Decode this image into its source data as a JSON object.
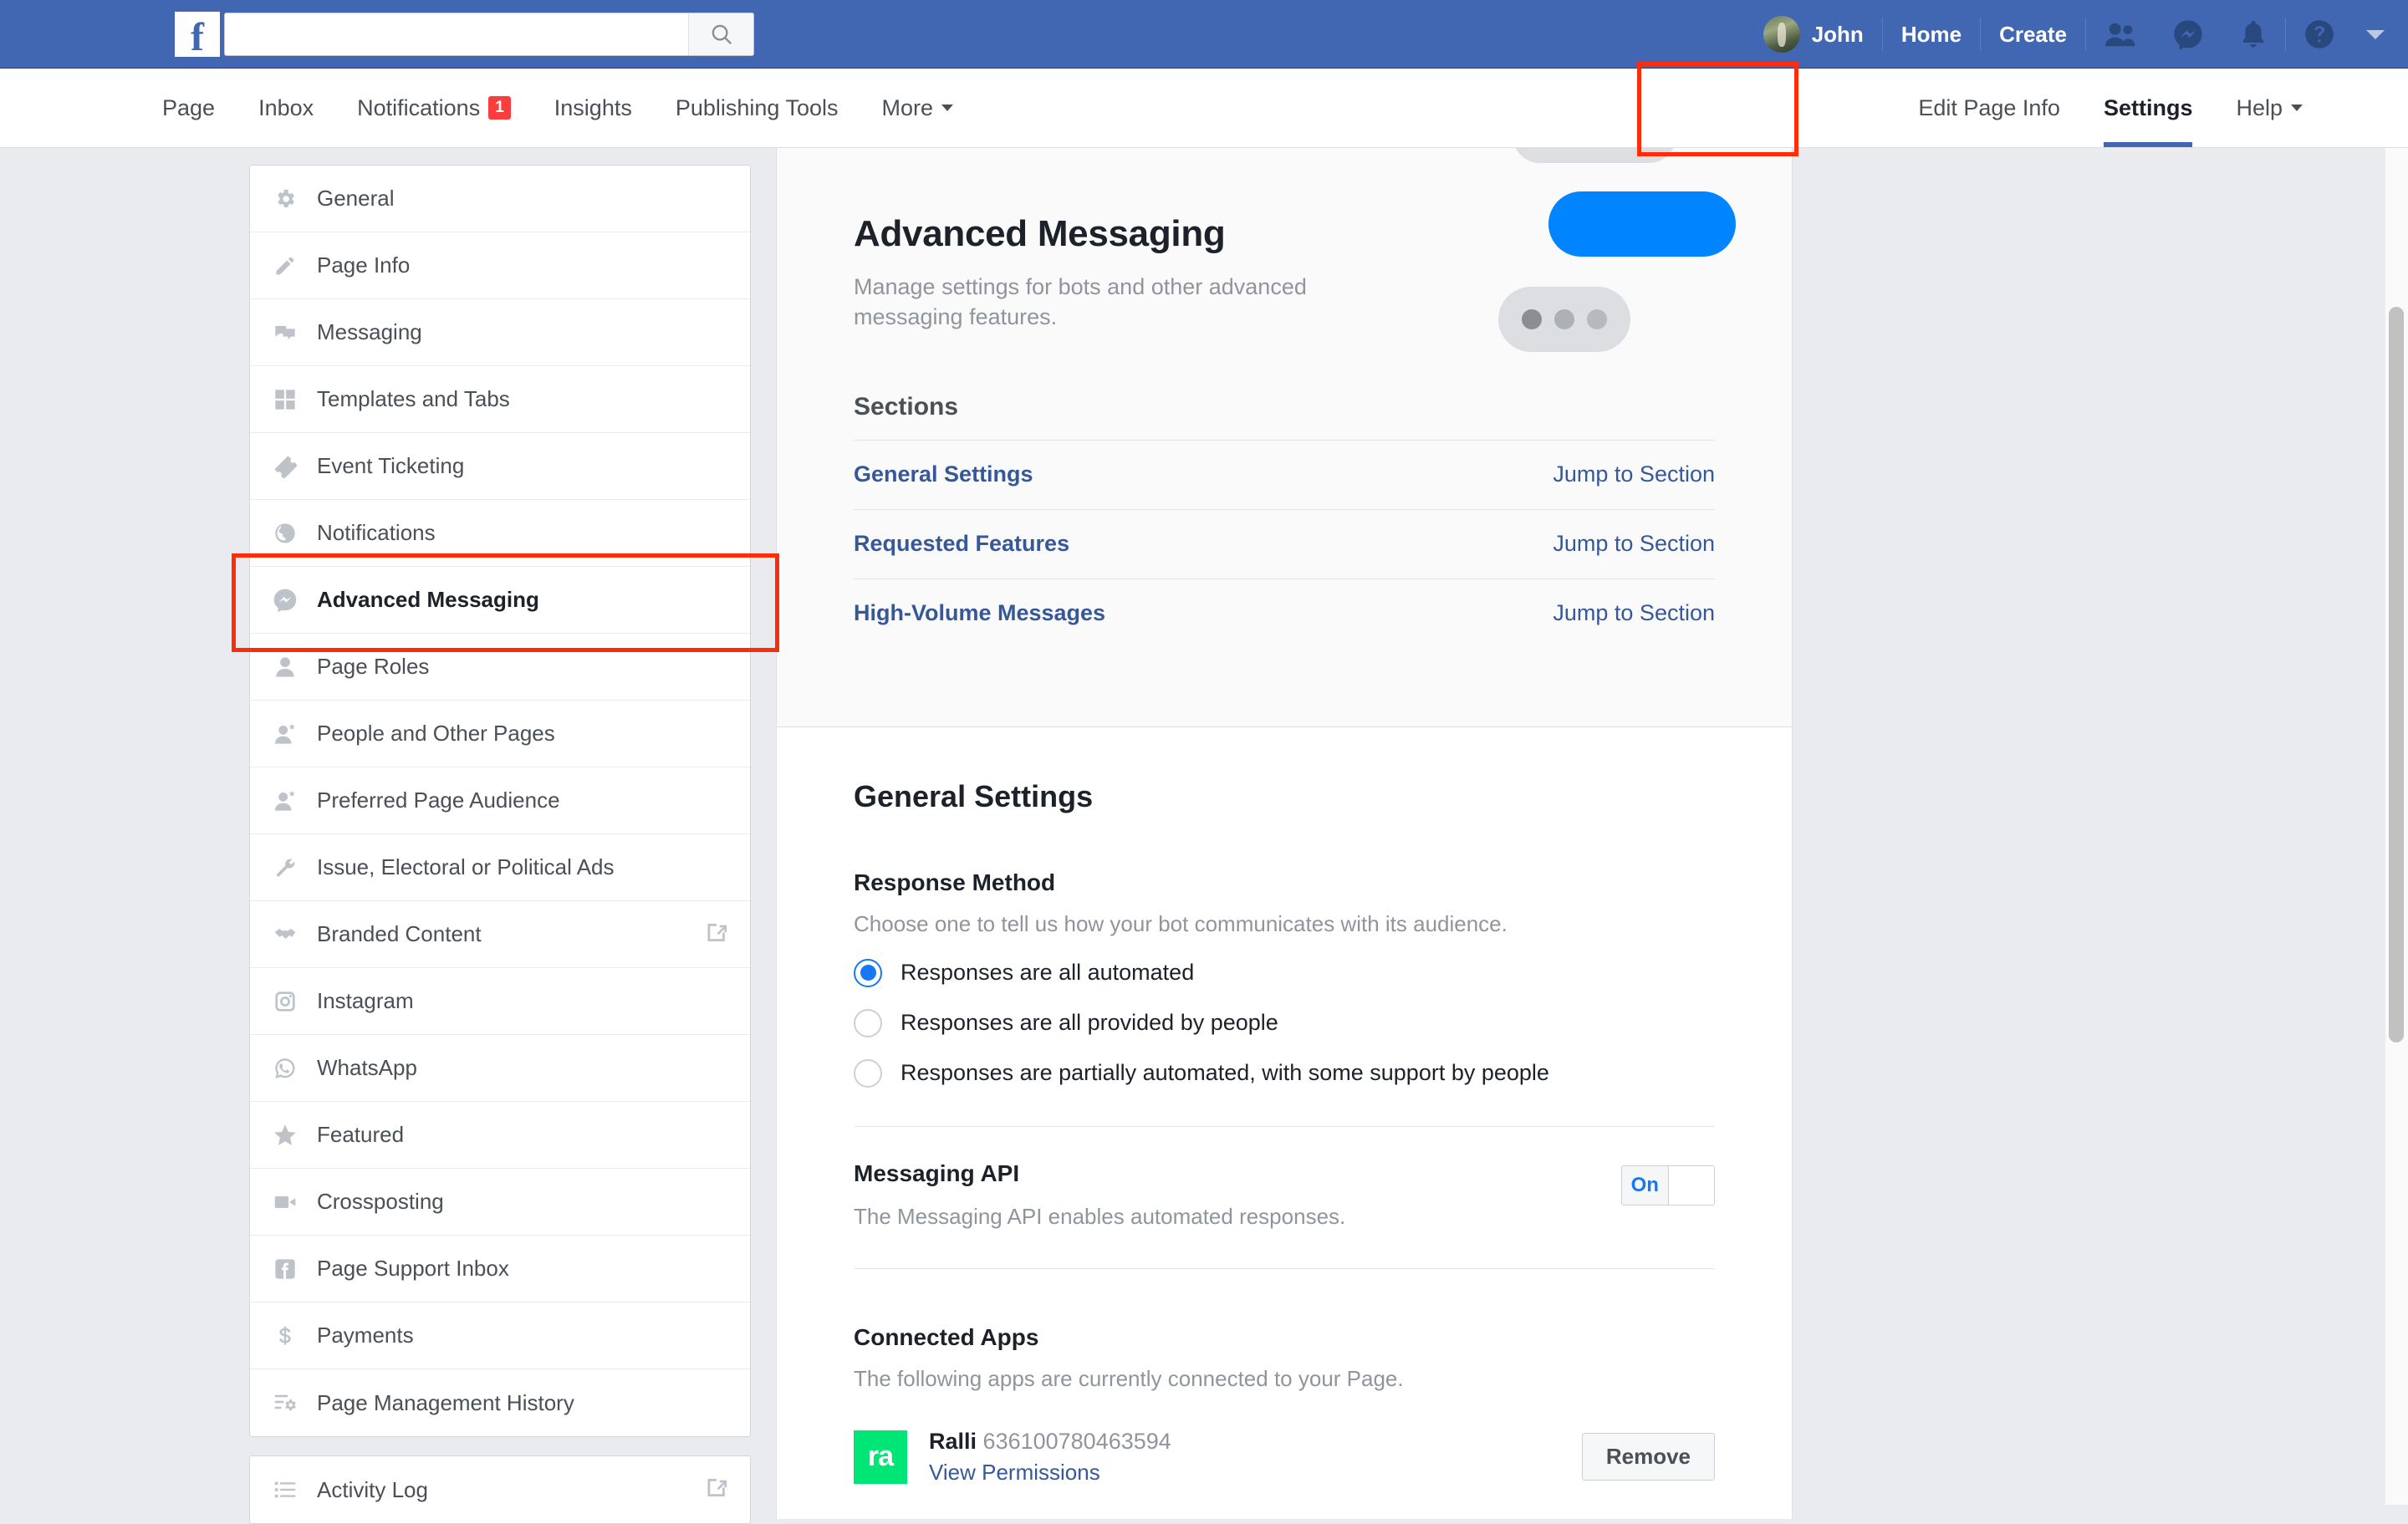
{
  "topbar": {
    "logo": "f",
    "search": {
      "value": "",
      "placeholder": ""
    },
    "search_icon": "search-icon",
    "profile_name": "John",
    "links": [
      "Home",
      "Create"
    ],
    "icons": [
      "friend-requests-icon",
      "messenger-icon",
      "notifications-bell-icon",
      "help-question-icon",
      "account-caret-icon"
    ]
  },
  "subnav": {
    "left_items": [
      {
        "label": "Page",
        "badge": null
      },
      {
        "label": "Inbox",
        "badge": null
      },
      {
        "label": "Notifications",
        "badge": "1"
      },
      {
        "label": "Insights",
        "badge": null
      },
      {
        "label": "Publishing Tools",
        "badge": null
      },
      {
        "label": "More",
        "caret": true
      }
    ],
    "right_items": [
      {
        "label": "Edit Page Info",
        "active": false
      },
      {
        "label": "Settings",
        "active": true
      },
      {
        "label": "Help",
        "caret": true
      }
    ]
  },
  "sidebar": {
    "items": [
      {
        "label": "General",
        "icon": "gear-icon"
      },
      {
        "label": "Page Info",
        "icon": "pencil-icon"
      },
      {
        "label": "Messaging",
        "icon": "chat-bubbles-icon"
      },
      {
        "label": "Templates and Tabs",
        "icon": "grid-squares-icon"
      },
      {
        "label": "Event Ticketing",
        "icon": "ticket-icon"
      },
      {
        "label": "Notifications",
        "icon": "globe-icon"
      },
      {
        "label": "Advanced Messaging",
        "icon": "messenger-bubble-icon",
        "selected": true
      },
      {
        "label": "Page Roles",
        "icon": "person-icon"
      },
      {
        "label": "People and Other Pages",
        "icon": "person-star-icon"
      },
      {
        "label": "Preferred Page Audience",
        "icon": "person-star-icon"
      },
      {
        "label": "Issue, Electoral or Political Ads",
        "icon": "wrench-icon"
      },
      {
        "label": "Branded Content",
        "icon": "handshake-icon",
        "external": true
      },
      {
        "label": "Instagram",
        "icon": "instagram-icon"
      },
      {
        "label": "WhatsApp",
        "icon": "whatsapp-icon"
      },
      {
        "label": "Featured",
        "icon": "star-icon"
      },
      {
        "label": "Crossposting",
        "icon": "video-camera-icon"
      },
      {
        "label": "Page Support Inbox",
        "icon": "facebook-square-icon"
      },
      {
        "label": "Payments",
        "icon": "dollar-sign-icon"
      },
      {
        "label": "Page Management History",
        "icon": "list-gear-icon"
      }
    ],
    "secondary_items": [
      {
        "label": "Activity Log",
        "icon": "list-lines-icon",
        "external": true
      }
    ]
  },
  "main": {
    "title": "Advanced Messaging",
    "subtitle": "Manage settings for bots and other advanced messaging features.",
    "sections_heading": "Sections",
    "sections": [
      {
        "label": "General Settings",
        "action": "Jump to Section"
      },
      {
        "label": "Requested Features",
        "action": "Jump to Section"
      },
      {
        "label": "High-Volume Messages",
        "action": "Jump to Section"
      }
    ],
    "general_settings": {
      "title": "General Settings",
      "response_method": {
        "heading": "Response Method",
        "description": "Choose one to tell us how your bot communicates with its audience.",
        "options": [
          {
            "label": "Responses are all automated",
            "selected": true
          },
          {
            "label": "Responses are all provided by people",
            "selected": false
          },
          {
            "label": "Responses are partially automated, with some support by people",
            "selected": false
          }
        ]
      },
      "messaging_api": {
        "heading": "Messaging API",
        "description": "The Messaging API enables automated responses.",
        "toggle_on_label": "On",
        "toggle_state": "on"
      },
      "connected_apps": {
        "heading": "Connected Apps",
        "description": "The following apps are currently connected to your Page.",
        "apps": [
          {
            "logo_text": "ra",
            "logo_color": "#00e676",
            "name": "Ralli",
            "id": "636100780463594",
            "permissions_link": "View Permissions",
            "remove_label": "Remove"
          }
        ]
      }
    }
  },
  "colors": {
    "fb_blue": "#4267b2",
    "link_blue": "#365899",
    "accent_blue": "#1877f2",
    "bubble_blue": "#0084ff",
    "badge_red": "#fa3e3e",
    "highlight_red": "#fb2d0b",
    "ralli_green": "#00e676"
  }
}
